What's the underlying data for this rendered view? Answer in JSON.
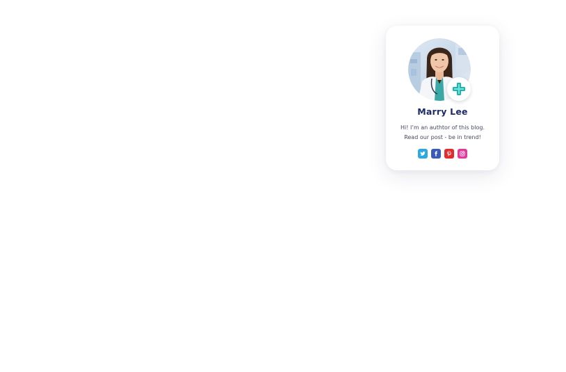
{
  "author": {
    "name": "Marry Lee",
    "bio_line_1": "Hi! I’m an authtor of this blog.",
    "bio_line_2": "Read our post - be in trend!",
    "avatar_icon": "doctor-photo",
    "badge_icon": "medical-cross-icon"
  },
  "socials": [
    {
      "name": "twitter",
      "icon": "twitter-icon",
      "color": "#2fa7e0"
    },
    {
      "name": "facebook",
      "icon": "facebook-icon",
      "color": "#3b5bb6"
    },
    {
      "name": "pinterest",
      "icon": "pinterest-icon",
      "color": "#e52b2b"
    },
    {
      "name": "instagram",
      "icon": "instagram-icon",
      "color": "#e23a9a"
    }
  ],
  "colors": {
    "name": "#1d2a6b",
    "text": "#444a5e",
    "accent": "#16b8b0"
  }
}
